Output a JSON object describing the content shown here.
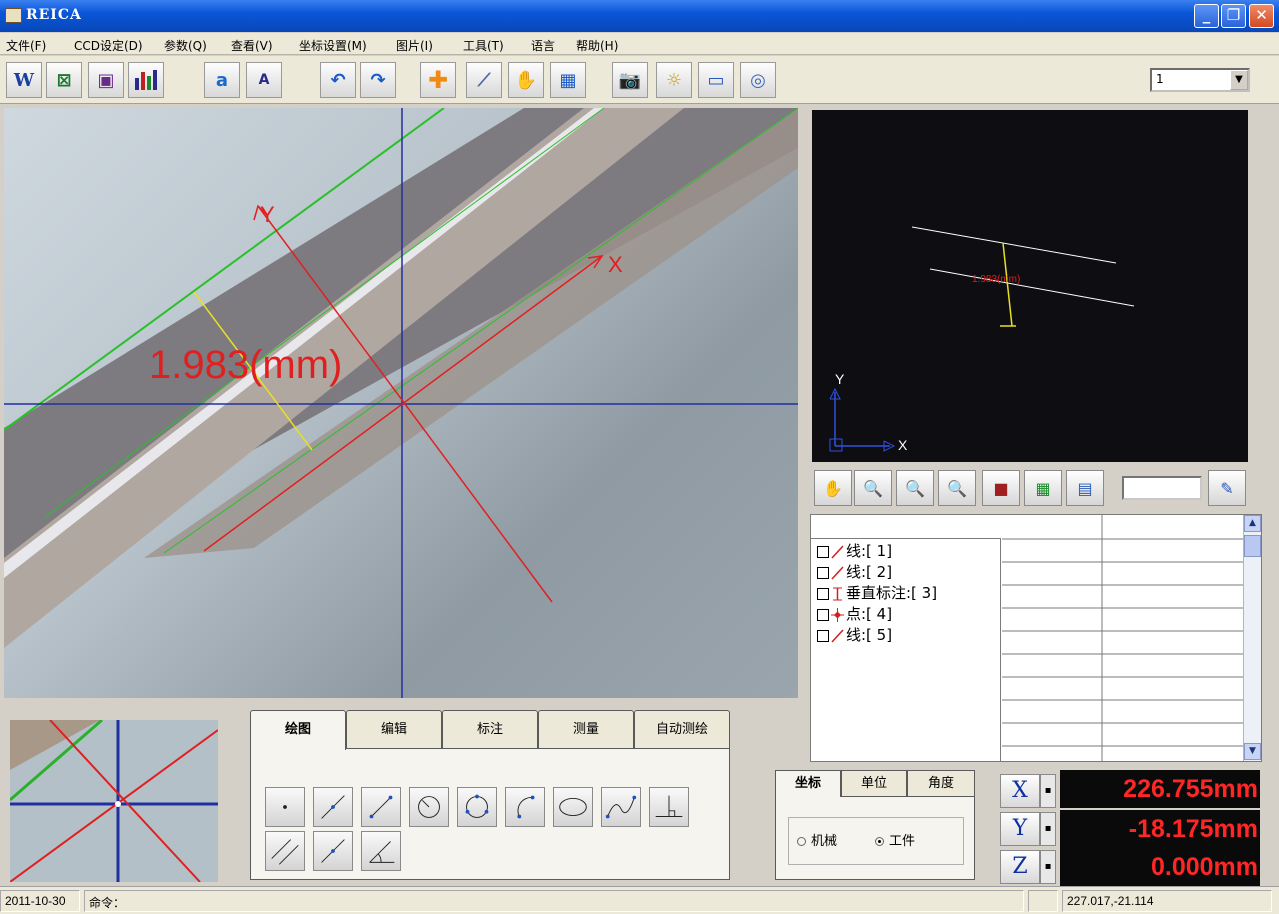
{
  "window": {
    "title": "REICA"
  },
  "menu": [
    "文件(F)",
    "CCD设定(D)",
    "参数(Q)",
    "查看(V)",
    "坐标设置(M)",
    "图片(I)",
    "工具(T)",
    "语言",
    "帮助(H)"
  ],
  "toolbar": {
    "icons": [
      "word-export-icon",
      "excel-export-icon",
      "save-icon",
      "chart-icon",
      "image-text-icon",
      "report-icon",
      "undo-icon",
      "redo-icon",
      "crosshair-icon",
      "probe-icon",
      "pan-hand-icon",
      "grid-icon",
      "camera-icon",
      "light-icon",
      "window-icon",
      "settings-icon"
    ],
    "combo_value": "1"
  },
  "main_view": {
    "measurement_label": "1.983(mm)",
    "x_axis_label": "X",
    "y_axis_label": "Y"
  },
  "preview": {
    "measurement_label": "1.983(mm)",
    "axis_x": "X",
    "axis_y": "Y"
  },
  "zoom_tools": [
    "pan-hand-icon",
    "zoom-in-icon",
    "zoom-fit-icon",
    "zoom-out-icon",
    "clear-icon",
    "layout-icon",
    "grid-icon"
  ],
  "object_list": [
    {
      "label": "线:[ 1]",
      "icon": "line-icon"
    },
    {
      "label": "线:[ 2]",
      "icon": "line-icon"
    },
    {
      "label": "垂直标注:[ 3]",
      "icon": "vertical-dimension-icon"
    },
    {
      "label": "点:[ 4]",
      "icon": "point-icon"
    },
    {
      "label": "线:[ 5]",
      "icon": "line-icon"
    }
  ],
  "draw_tabs": [
    "绘图",
    "编辑",
    "标注",
    "测量",
    "自动测绘"
  ],
  "draw_tools": [
    "point-tool-icon",
    "line-tool-icon",
    "segment-tool-icon",
    "circle-center-tool-icon",
    "circle-tool-icon",
    "arc-tool-icon",
    "ellipse-tool-icon",
    "curve-tool-icon",
    "perpendicular-tool-icon",
    "parallel-tool-icon",
    "bisector-tool-icon",
    "angle-tool-icon"
  ],
  "coord_tabs": [
    "坐标",
    "单位",
    "角度"
  ],
  "coord_mode": {
    "options": [
      "机械",
      "工件"
    ],
    "selected": "工件"
  },
  "readouts": [
    {
      "axis": "X",
      "value": "226.755mm"
    },
    {
      "axis": "Y",
      "value": "-18.175mm"
    },
    {
      "axis": "Z",
      "value": "0.000mm"
    }
  ],
  "status": {
    "date": "2011-10-30",
    "command_label": "命令：",
    "cursor_coords": "227.017,-21.114"
  },
  "colors": {
    "title_bar": "#0a56d8",
    "readout_text": "#ff2626",
    "measure_red": "#e02020",
    "axis_blue": "#2030a0"
  }
}
